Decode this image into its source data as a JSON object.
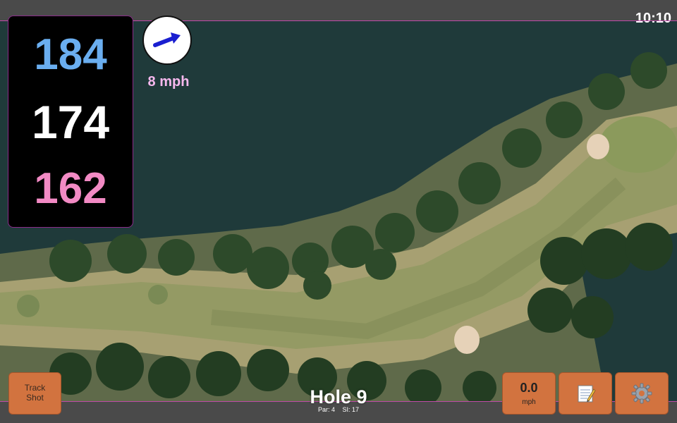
{
  "status_bar": {
    "time": "10:10"
  },
  "yardages": {
    "back": "184",
    "middle": "174",
    "front": "162"
  },
  "wind": {
    "speed_label": "8 mph",
    "direction": "east-north-east"
  },
  "hole": {
    "title": "Hole 9",
    "par_label": "Par: 4",
    "si_label": "SI: 17"
  },
  "buttons": {
    "track_shot": {
      "line1": "Track",
      "line2": "Shot"
    },
    "wind_input": {
      "value": "0.0",
      "unit": "mph"
    },
    "notes_icon": "notepad-icon",
    "settings_icon": "gear-icon"
  },
  "colors": {
    "back_yardage": "#6aaef0",
    "middle_yardage": "#ffffff",
    "front_yardage": "#f28ac4",
    "wind_label": "#f6b8ee",
    "button": "#d2733f",
    "accent_line": "#c04aa8"
  }
}
